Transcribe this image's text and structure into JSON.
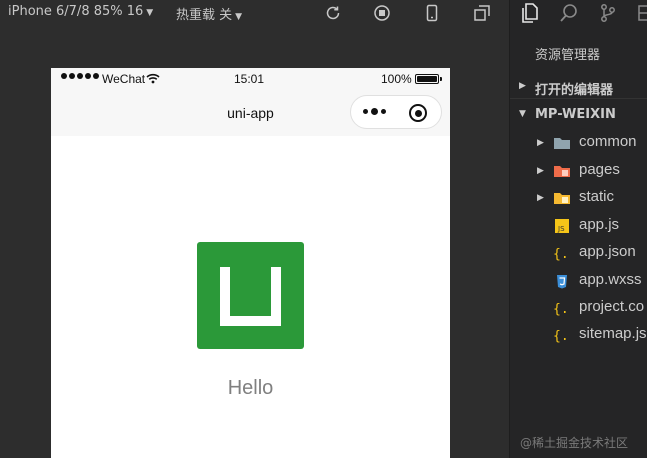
{
  "sim_toolbar": {
    "device": "iPhone 6/7/8 85% 16",
    "hot_reload": "热重载 关"
  },
  "phone": {
    "status": {
      "carrier": "WeChat",
      "time": "15:01",
      "battery": "100%"
    },
    "nav_title": "uni-app",
    "hello": "Hello"
  },
  "explorer": {
    "title": "资源管理器",
    "open_editors": "打开的编辑器",
    "project": "MP-WEIXIN",
    "items": [
      {
        "name": "common",
        "type": "folder",
        "icon": "folder-icon"
      },
      {
        "name": "pages",
        "type": "folder",
        "icon": "pages-folder-icon"
      },
      {
        "name": "static",
        "type": "folder",
        "icon": "static-folder-icon"
      },
      {
        "name": "app.js",
        "type": "file",
        "icon": "js-file-icon"
      },
      {
        "name": "app.json",
        "type": "file",
        "icon": "json-file-icon"
      },
      {
        "name": "app.wxss",
        "type": "file",
        "icon": "css-file-icon"
      },
      {
        "name": "project.co",
        "type": "file",
        "icon": "json-file-icon"
      },
      {
        "name": "sitemap.js",
        "type": "file",
        "icon": "json-file-icon"
      }
    ]
  },
  "watermark": "@稀土掘金技术社区",
  "colors": {
    "logo_green": "#2b9939",
    "ide_bg": "#2d2d2d",
    "explorer_bg": "#252526"
  }
}
